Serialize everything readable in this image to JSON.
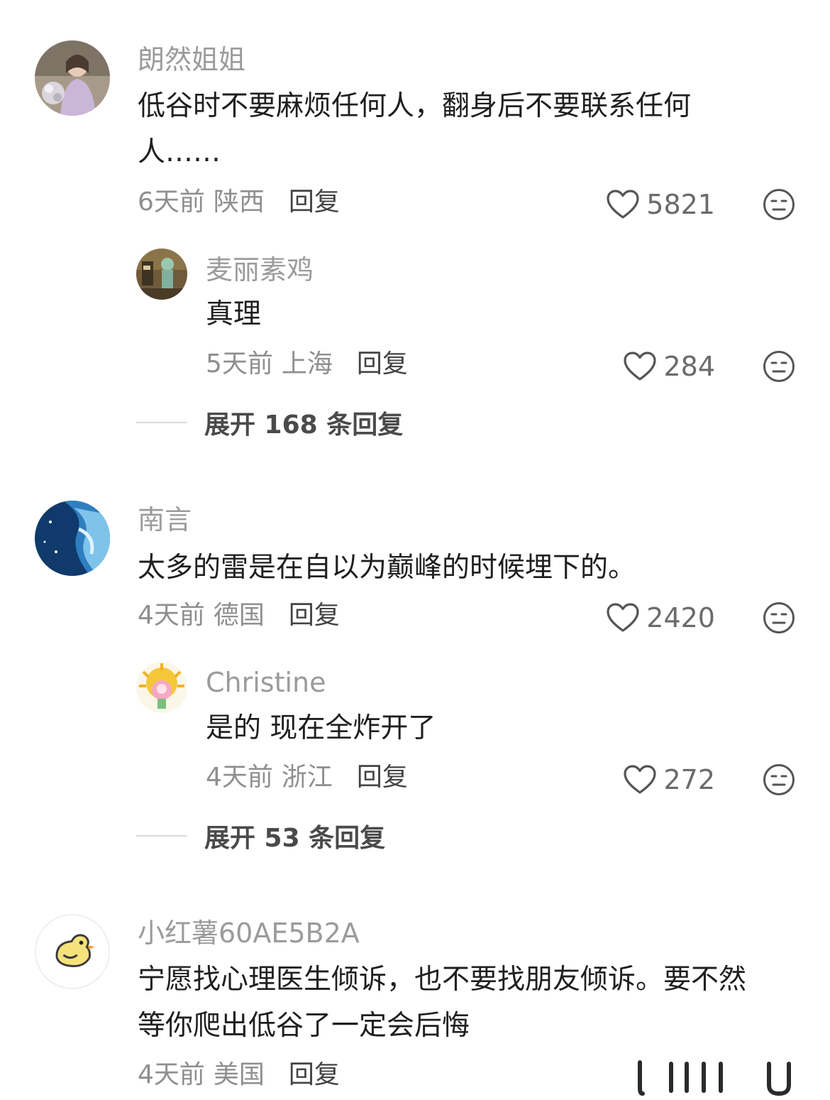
{
  "comments": [
    {
      "username": "朗然姐姐",
      "text_lines": [
        "低谷时不要麻烦任何人，翻身后不要联系任何",
        "人……"
      ],
      "time": "6天前",
      "location": "陕西",
      "reply_label": "回复",
      "likes": "5821",
      "replies": [
        {
          "username": "麦丽素鸡",
          "text": "真理",
          "time": "5天前",
          "location": "上海",
          "reply_label": "回复",
          "likes": "284"
        }
      ],
      "expand_label": "展开 168 条回复"
    },
    {
      "username": "南言",
      "text_lines": [
        "太多的雷是在自以为巅峰的时候埋下的。"
      ],
      "time": "4天前",
      "location": "德国",
      "reply_label": "回复",
      "likes": "2420",
      "replies": [
        {
          "username": "Christine",
          "text": "是的 现在全炸开了",
          "time": "4天前",
          "location": "浙江",
          "reply_label": "回复",
          "likes": "272"
        }
      ],
      "expand_label": "展开 53 条回复"
    },
    {
      "username": "小红薯60AE5B2A",
      "text_lines": [
        "宁愿找心理医生倾诉，也不要找朋友倾诉。要不然",
        "等你爬出低谷了一定会后悔"
      ],
      "time": "4天前",
      "location": "美国",
      "reply_label": "回复"
    }
  ],
  "icons": {
    "like": "heart-outline-icon",
    "dislike": "meh-face-icon"
  },
  "colors": {
    "username": "#9b9b9b",
    "text": "#1f1f1f",
    "meta": "#8f8f8f",
    "icon": "#555555"
  }
}
